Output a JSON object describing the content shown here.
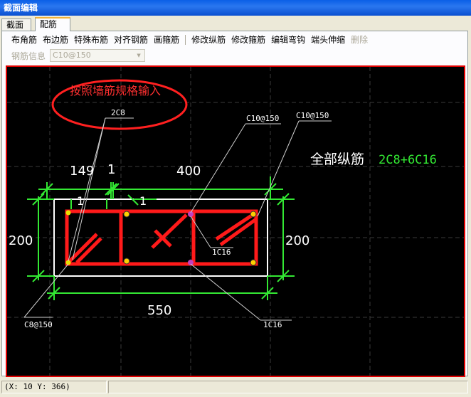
{
  "window": {
    "title": "截面编辑"
  },
  "tabs": [
    {
      "label": "截面"
    },
    {
      "label": "配筋"
    }
  ],
  "toolbar": {
    "buttons": [
      {
        "label": "布角筋"
      },
      {
        "label": "布边筋"
      },
      {
        "label": "特殊布筋"
      },
      {
        "label": "对齐钢筋"
      },
      {
        "label": "画箍筋"
      },
      {
        "label": "修改纵筋"
      },
      {
        "label": "修改箍筋"
      },
      {
        "label": "编辑弯钩"
      },
      {
        "label": "端头伸缩"
      },
      {
        "label": "删除"
      }
    ]
  },
  "rebar_info": {
    "label": "钢筋信息",
    "value": "C10@150"
  },
  "drawing": {
    "note": "按照墙筋规格输入",
    "label_2c8": "2C8",
    "label_c10_a": "C10@150",
    "label_c10_b": "C10@150",
    "total_label": "全部纵筋",
    "total_value": "2C8+6C16",
    "dim_149": "149",
    "dim_1_top": "1",
    "dim_400": "400",
    "dim_1_left": "1",
    "dim_1_right": "1",
    "dim_200_left": "200",
    "dim_200_right": "200",
    "dim_550": "550",
    "label_1c16_inner": "1C16",
    "label_1c16_bottom": "1C16",
    "label_c8": "C8@150"
  },
  "status": {
    "coords": "(X: 10 Y: 366)"
  },
  "colors": {
    "canvas_bg": "#000000",
    "stirrup": "#ff1a1a",
    "dimension": "#33e833",
    "outline": "#ffffff",
    "titlebar": "#0a5fe6"
  }
}
